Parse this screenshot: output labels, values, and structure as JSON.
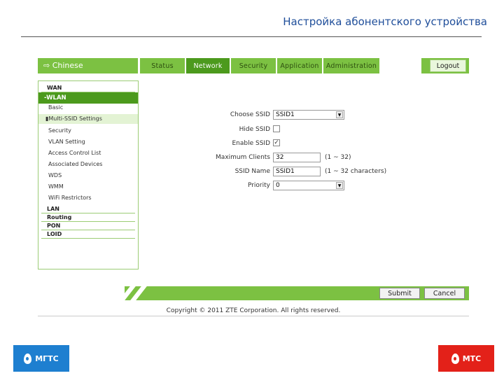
{
  "slide": {
    "title": "Настройка абонентского устройства"
  },
  "header": {
    "language": "Chinese",
    "tabs": [
      "Status",
      "Network",
      "Security",
      "Application",
      "Administration"
    ],
    "active_tab": "Network",
    "logout_label": "Logout"
  },
  "sidebar": {
    "wan": "WAN",
    "wlan": "-WLAN",
    "wlan_items": [
      "Basic",
      "Multi-SSID Settings",
      "Security",
      "VLAN Setting",
      "Access Control List",
      "Associated Devices",
      "WDS",
      "WMM",
      "WiFi Restrictors"
    ],
    "selected_item": "Multi-SSID Settings",
    "lan": "LAN",
    "routing": "Routing",
    "pon": "PON",
    "loid": "LOID"
  },
  "form": {
    "choose_ssid": {
      "label": "Choose SSID",
      "value": "SSID1"
    },
    "hide_ssid": {
      "label": "Hide SSID",
      "checked": false
    },
    "enable_ssid": {
      "label": "Enable SSID",
      "checked": true,
      "mark": "✓"
    },
    "maximum_clients": {
      "label": "Maximum Clients",
      "value": "32",
      "hint": "(1 ~ 32)"
    },
    "ssid_name": {
      "label": "SSID Name",
      "value": "SSID1",
      "hint": "(1 ~ 32 characters)"
    },
    "priority": {
      "label": "Priority",
      "value": "0"
    }
  },
  "actions": {
    "submit": "Submit",
    "cancel": "Cancel"
  },
  "footer": {
    "copyright": "Copyright © 2011 ZTE Corporation. All rights reserved."
  },
  "logos": {
    "left": "МГТС",
    "right": "МТС"
  },
  "colors": {
    "green": "#7cc142",
    "dark_green": "#4c9a1d",
    "title_blue": "#1f4e9a",
    "mgts_blue": "#1e7fd0",
    "mts_red": "#e32119"
  }
}
